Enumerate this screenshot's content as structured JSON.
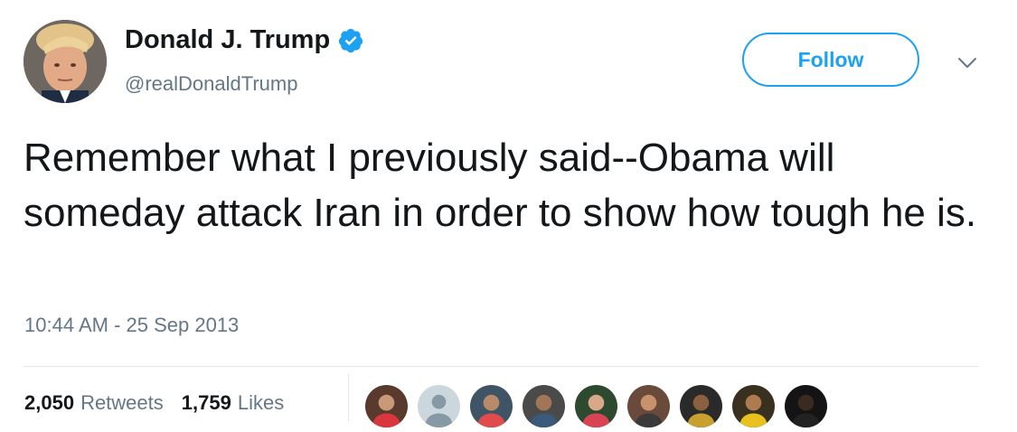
{
  "user": {
    "display_name": "Donald J. Trump",
    "handle": "@realDonaldTrump",
    "verified": true,
    "avatar_icon": "profile-photo"
  },
  "follow_label": "Follow",
  "tweet": {
    "text": "Remember what I previously said--Obama will someday attack Iran in order to show how tough he is.",
    "timestamp": "10:44 AM - 25 Sep 2013"
  },
  "stats": {
    "retweets_count": "2,050",
    "retweets_label": "Retweets",
    "likes_count": "1,759",
    "likes_label": "Likes"
  },
  "likers": [
    {
      "bg": "#5a3a2c",
      "face": "#c99a7a",
      "shirt": "#d9363e"
    },
    {
      "bg": "#ccd6dd",
      "face": "#8899a6",
      "shirt": "#8899a6",
      "default": true
    },
    {
      "bg": "#3f5566",
      "face": "#b98a6a",
      "shirt": "#e14b4b"
    },
    {
      "bg": "#4a4a4a",
      "face": "#a07656",
      "shirt": "#3b5a7a"
    },
    {
      "bg": "#2e4a2e",
      "face": "#d8a888",
      "shirt": "#d94455"
    },
    {
      "bg": "#6a4a3a",
      "face": "#c8926c",
      "shirt": "#3a3a3a"
    },
    {
      "bg": "#2a2a2a",
      "face": "#8a6040",
      "shirt": "#c8a030"
    },
    {
      "bg": "#3a3020",
      "face": "#b07a50",
      "shirt": "#e8c020"
    },
    {
      "bg": "#141414",
      "face": "#3a2a20",
      "shirt": "#222222"
    }
  ],
  "colors": {
    "accent": "#1da1f2",
    "secondary_text": "#657786",
    "primary_text": "#14171a",
    "border": "#e1e8ed"
  }
}
